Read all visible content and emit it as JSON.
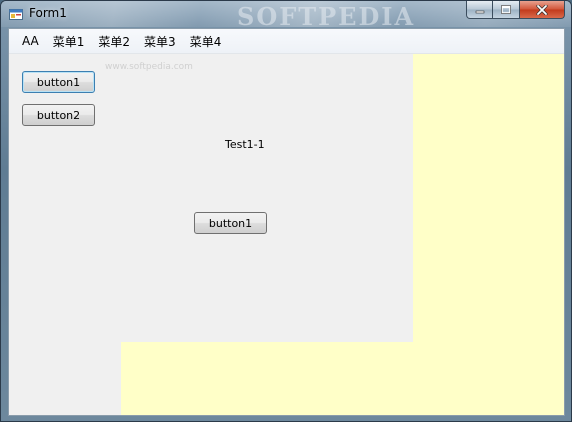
{
  "window": {
    "title": "Form1",
    "watermark": "SOFTPEDIA",
    "watermark_url": "www.softpedia.com",
    "caption_buttons": [
      "minimize",
      "maximize",
      "close"
    ]
  },
  "menu": {
    "items": [
      "AA",
      "菜单1",
      "菜单2",
      "菜单3",
      "菜单4"
    ]
  },
  "content": {
    "button1_label": "button1",
    "button2_label": "button2",
    "label_text": "Test1-1",
    "center_button_label": "button1"
  },
  "colors": {
    "panel_yellow": "#ffffc8",
    "form_background": "#f0f0f0",
    "close_red": "#c23a1c"
  }
}
